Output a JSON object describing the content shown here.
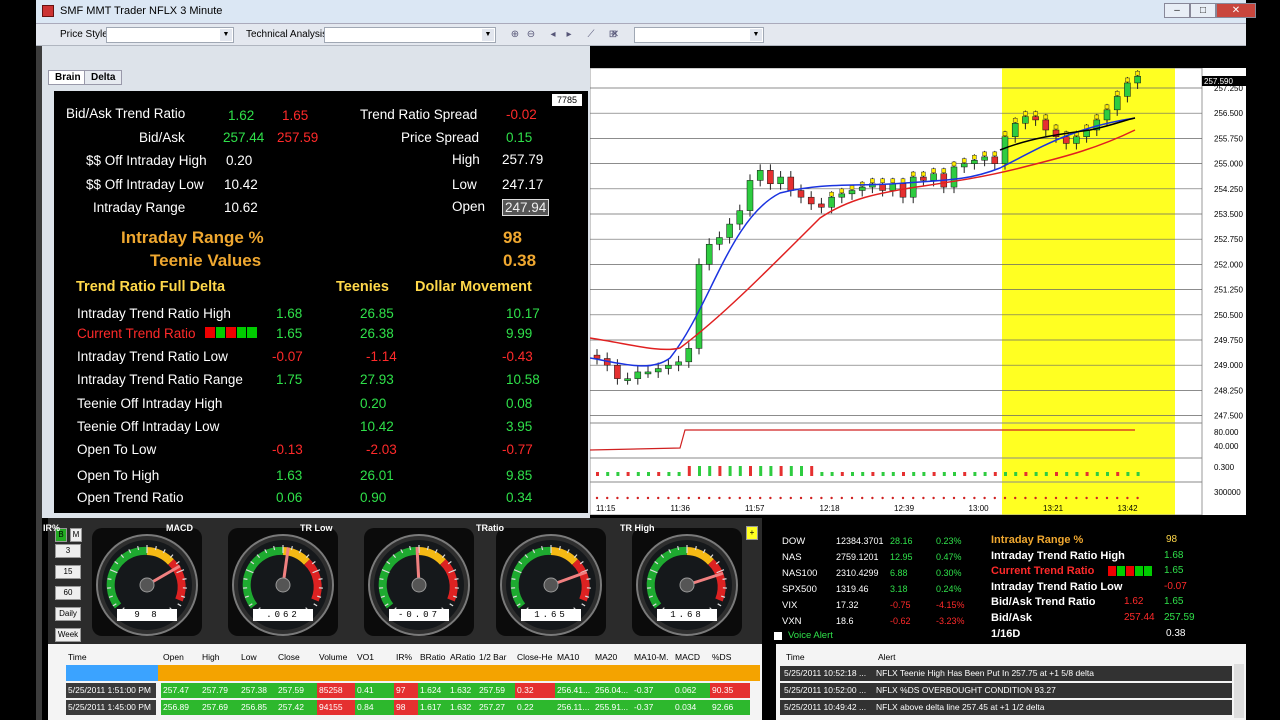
{
  "window": {
    "title": "SMF MMT Trader NFLX  3 Minute",
    "buttons": [
      "–",
      "□",
      "✕"
    ]
  },
  "toolbar": {
    "price_style_label": "Price Style",
    "tech_analysis_label": "Technical Analysis"
  },
  "tabs": [
    "Brain",
    "Delta"
  ],
  "brain": {
    "badge": "7785",
    "rows": {
      "bidask_trend_ratio": {
        "label": "Bid/Ask Trend Ratio",
        "v1": "1.62",
        "v2": "1.65"
      },
      "bidask": {
        "label": "Bid/Ask",
        "v1": "257.44",
        "v2": "257.59"
      },
      "off_high": {
        "label": "$$ Off Intraday High",
        "v": "0.20"
      },
      "off_low": {
        "label": "$$ Off Intraday Low",
        "v": "10.42"
      },
      "intraday_range": {
        "label": "Intraday Range",
        "v": "10.62"
      },
      "trend_ratio_spread": {
        "label": "Trend Ratio Spread",
        "v": "-0.02"
      },
      "price_spread": {
        "label": "Price Spread",
        "v": "0.15"
      },
      "high": {
        "label": "High",
        "v": "257.79"
      },
      "low": {
        "label": "Low",
        "v": "247.17"
      },
      "open": {
        "label": "Open",
        "v": "247.94"
      }
    },
    "range_pct": {
      "label": "Intraday Range %",
      "v": "98"
    },
    "teenie_values": {
      "label": "Teenie Values",
      "v": "0.38"
    },
    "table_headers": {
      "name": "Trend Ratio Full Delta",
      "teenies": "Teenies",
      "dollar": "Dollar Movement"
    },
    "table": [
      {
        "label": "Intraday Trend Ratio High",
        "v": "1.68",
        "t": "26.85",
        "d": "10.17",
        "c": "g"
      },
      {
        "label": "Current Trend Ratio",
        "v": "1.65",
        "t": "26.38",
        "d": "9.99",
        "c": "g",
        "lc": "r"
      },
      {
        "label": "Intraday Trend Ratio Low",
        "v": "-0.07",
        "t": "-1.14",
        "d": "-0.43",
        "c": "r"
      },
      {
        "label": "Intraday Trend Ratio Range",
        "v": "1.75",
        "t": "27.93",
        "d": "10.58",
        "c": "g"
      },
      {
        "label": "Teenie Off Intraday High",
        "v": "",
        "t": "0.20",
        "d": "0.08",
        "c": "g"
      },
      {
        "label": "Teenie Off Intraday Low",
        "v": "",
        "t": "10.42",
        "d": "3.95",
        "c": "g"
      },
      {
        "label": "Open To Low",
        "v": "-0.13",
        "t": "-2.03",
        "d": "-0.77",
        "c": "r"
      },
      {
        "label": "Open To High",
        "v": "1.63",
        "t": "26.01",
        "d": "9.85",
        "c": "g"
      },
      {
        "label": "Open Trend Ratio",
        "v": "0.06",
        "t": "0.90",
        "d": "0.34",
        "c": "g"
      }
    ]
  },
  "chart": {
    "last_price": "257.590",
    "price_ticks": [
      "257.250",
      "256.500",
      "255.750",
      "255.000",
      "254.250",
      "253.500",
      "252.750",
      "252.000",
      "251.250",
      "250.500",
      "249.750",
      "249.000",
      "248.250",
      "247.500"
    ],
    "ind_ticks": [
      "80.000",
      "40.000",
      "0.300",
      "300000"
    ],
    "time_ticks": [
      "11:15",
      "11:36",
      "11:57",
      "12:18",
      "12:39",
      "13:00",
      "13:21",
      "13:42"
    ]
  },
  "gauges": {
    "buttons": [
      "B",
      "M",
      "3",
      "15",
      "60",
      "Daily",
      "Week"
    ],
    "items": [
      {
        "label": "IR%",
        "value": "9 8",
        "angle": 60
      },
      {
        "label": "MACD",
        "value": ".062",
        "angle": 8
      },
      {
        "label": "TR Low",
        "value": "-0.07",
        "angle": -3
      },
      {
        "label": "TRatio",
        "value": "1.65",
        "angle": 70
      },
      {
        "label": "TR High",
        "value": "1.68",
        "angle": 72
      }
    ],
    "plus": "+"
  },
  "market": {
    "rows": [
      {
        "sym": "DOW",
        "val": "12384.3701",
        "chg": "28.16",
        "pct": "0.23%",
        "c": "g"
      },
      {
        "sym": "NAS",
        "val": "2759.1201",
        "chg": "12.95",
        "pct": "0.47%",
        "c": "g"
      },
      {
        "sym": "NAS100",
        "val": "2310.4299",
        "chg": "6.88",
        "pct": "0.30%",
        "c": "g"
      },
      {
        "sym": "SPX500",
        "val": "1319.46",
        "chg": "3.18",
        "pct": "0.24%",
        "c": "g"
      },
      {
        "sym": "VIX",
        "val": "17.32",
        "chg": "-0.75",
        "pct": "-4.15%",
        "c": "r"
      },
      {
        "sym": "VXN",
        "val": "18.6",
        "chg": "-0.62",
        "pct": "-3.23%",
        "c": "r"
      }
    ],
    "voice_alert": "Voice Alert",
    "right": [
      {
        "label": "Intraday Range %",
        "v1": "98",
        "v2": "",
        "lc": "o"
      },
      {
        "label": "Intraday Trend Ratio High",
        "v1": "",
        "v2": "1.68",
        "lc": "w"
      },
      {
        "label": "Current Trend Ratio",
        "v1": "",
        "v2": "1.65",
        "lc": "r"
      },
      {
        "label": "Intraday Trend Ratio Low",
        "v1": "",
        "v2": "-0.07",
        "lc": "w"
      },
      {
        "label": "Bid/Ask Trend Ratio",
        "v1": "1.62",
        "v2": "1.65",
        "lc": "w"
      },
      {
        "label": "Bid/Ask",
        "v1": "257.44",
        "v2": "257.59",
        "lc": "w"
      },
      {
        "label": "1/16D",
        "v1": "",
        "v2": "0.38",
        "lc": "w"
      }
    ]
  },
  "grid": {
    "headers": [
      "Time",
      "Open",
      "High",
      "Low",
      "Close",
      "Volume",
      "VO1",
      "IR%",
      "BRatio",
      "ARatio",
      "1/2 Bar",
      "Close-He",
      "MA10",
      "MA20",
      "MA10-M.",
      "MACD",
      "%DS"
    ],
    "rows": [
      [
        "5/25/2011 1:51:00 PM",
        "257.47",
        "257.79",
        "257.38",
        "257.59",
        "85258",
        "0.41",
        "97",
        "1.624",
        "1.632",
        "257.59",
        "0.32",
        "256.41...",
        "256.04...",
        "-0.37",
        "0.062",
        "90.35"
      ],
      [
        "5/25/2011 1:45:00 PM",
        "256.89",
        "257.69",
        "256.85",
        "257.42",
        "94155",
        "0.84",
        "98",
        "1.617",
        "1.632",
        "257.27",
        "0.22",
        "256.11...",
        "255.91...",
        "-0.37",
        "0.034",
        "92.66"
      ]
    ]
  },
  "alerts": {
    "headers": [
      "Time",
      "Alert"
    ],
    "rows": [
      {
        "time": "5/25/2011 10:52:18 ...",
        "text": "NFLX Teenie High Has Been Put In 257.75 at  +1 5/8 delta"
      },
      {
        "time": "5/25/2011 10:52:00 ...",
        "text": "NFLX %DS OVERBOUGHT CONDITION 93.27"
      },
      {
        "time": "5/25/2011 10:49:42 ...",
        "text": "NFLX above delta line 257.45 at +1 1/2 delta"
      }
    ]
  },
  "colors": {
    "up": "#2fe04a",
    "down": "#ff2a2a",
    "highlight": "#ffff00",
    "label": "#ffd84a"
  }
}
